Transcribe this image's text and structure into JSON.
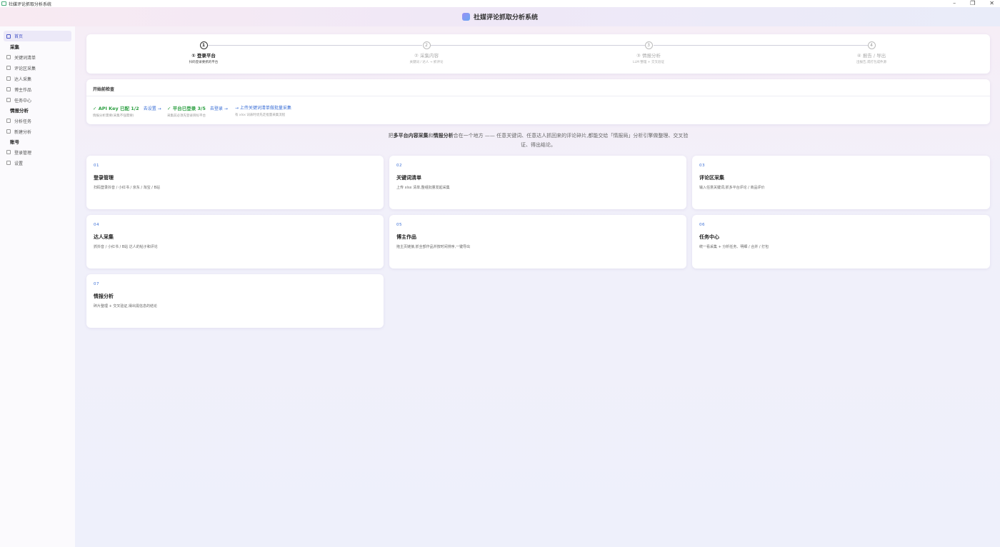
{
  "window": {
    "title": "社媒评论抓取分析系统",
    "controls": [
      "–",
      "❐",
      "✕"
    ]
  },
  "header": {
    "title": "社媒评论抓取分析系统"
  },
  "sidebar": {
    "home": "首页",
    "groups": [
      {
        "label": "采集",
        "items": [
          "关键词清单",
          "评论区采集",
          "达人采集",
          "博主作品",
          "任务中心"
        ]
      },
      {
        "label": "情报分析",
        "items": [
          "分析任务",
          "新建分析"
        ]
      },
      {
        "label": "账号",
        "items": [
          "登录管理",
          "设置"
        ]
      }
    ]
  },
  "steps": [
    {
      "num": "1",
      "label": "① 登录平台",
      "sub": "扫码登录要抓的平台",
      "active": true
    },
    {
      "num": "2",
      "label": "② 采集内容",
      "sub": "关键词 / 达人 → 抓评论",
      "active": false
    },
    {
      "num": "3",
      "label": "③ 情报分析",
      "sub": "LLM 整理 + 交叉验证",
      "active": false
    },
    {
      "num": "4",
      "label": "④ 报告 / 导出",
      "sub": "出报告,或打包成件源",
      "active": false
    }
  ],
  "precheck": {
    "title": "开始前检查",
    "checks": [
      {
        "status": "✓ API Key 已配 1/2",
        "link": "去设置 →",
        "hint": "情报分析需要(采集不强需要)"
      },
      {
        "status": "✓ 平台已登录 3/5",
        "link": "去登录 →",
        "hint": "采集前必须先登录目标平台"
      },
      {
        "status": "",
        "link": "→ 上传关键词清单做批量采集",
        "hint": "有 xlsx 词表时优先走批量采集流程"
      }
    ]
  },
  "intro": {
    "pre": "把",
    "bold1": "多平台内容采集",
    "mid": "和",
    "bold2": "情报分析",
    "post": "合在一个地方 —— 任意关键词、任意达人抓回来的评论碎片,都能交给「情报局」分析引擎做整理、交叉验证、得出结论。"
  },
  "modules": [
    {
      "num": "01",
      "title": "登录管理",
      "desc": "扫码登录抖音 / 小红书 / 京东 / 淘宝 / B站"
    },
    {
      "num": "02",
      "title": "关键词清单",
      "desc": "上传 xlsx 清单,整组批量发起采集"
    },
    {
      "num": "03",
      "title": "评论区采集",
      "desc": "输入任意关键词,抓多平台评论 / 商品评价"
    },
    {
      "num": "04",
      "title": "达人采集",
      "desc": "抓抖音 / 小红书 / B站 达人的帖子和评论"
    },
    {
      "num": "05",
      "title": "博主作品",
      "desc": "拖主页链接,抓全部作品并按时间排序,一键导出"
    },
    {
      "num": "06",
      "title": "任务中心",
      "desc": "统一看采集 + 分析任务、明细 / 合并 / 打包"
    },
    {
      "num": "07",
      "title": "情报分析",
      "desc": "碎片整理 + 交叉验证,得出需信息的结论"
    }
  ]
}
